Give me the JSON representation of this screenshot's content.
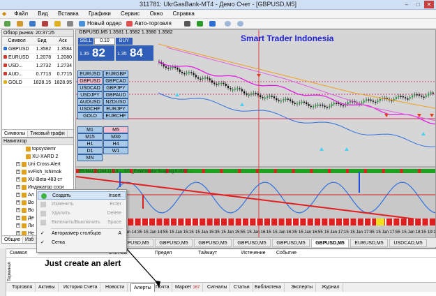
{
  "window": {
    "title": "311781: UkrGasBank-MT4 - Демо Счет - [GBPUSD,M5]"
  },
  "menu": [
    "Файл",
    "Вид",
    "Вставка",
    "Графики",
    "Сервис",
    "Окно",
    "Справка"
  ],
  "toolbar": {
    "new_order": "Новый ордер",
    "autotrading": "Авто-торговля"
  },
  "market_watch": {
    "title": "Обзор рынка: 20:37:25",
    "headers": [
      "Символ",
      "Бид",
      "Аск"
    ],
    "rows": [
      {
        "symbol": "GBPUSD",
        "bid": "1.3582",
        "ask": "1.3584",
        "color": "#2a6fd1"
      },
      {
        "symbol": "EURUSD",
        "bid": "1.2078",
        "ask": "1.2080",
        "color": "#d13a2a"
      },
      {
        "symbol": "USD...",
        "bid": "1.2732",
        "ask": "1.2734",
        "color": "#d13a2a"
      },
      {
        "symbol": "AUD...",
        "bid": "0.7713",
        "ask": "0.7715",
        "color": "#d13a2a"
      },
      {
        "symbol": "GOLD",
        "bid": "1828.15",
        "ask": "1828.95",
        "color": "#e0b020"
      }
    ],
    "tabs": [
      "Символы",
      "Тиковый графи"
    ]
  },
  "navigator": {
    "title": "Навигатор",
    "items": [
      "topsystemr",
      "XU-XARD 2",
      "Uni Cross Alert",
      "vvFish_Ishimok",
      "XU-Beta-483 ст",
      "Индикатор соси",
      "Ал",
      "Во",
      "Во",
      "Де",
      "Ли",
      "Не"
    ],
    "tabs": [
      "Общие",
      "Изб"
    ]
  },
  "chart": {
    "header": "GBPUSD,M5  1.3581 1.3582 1.3580 1.3582",
    "brand": "Smart Trader Indonesia",
    "trade_panel": {
      "sell": "SELL",
      "buy": "BUY",
      "lot": "0.10",
      "sell_price_small": "1.35",
      "sell_price_big": "82",
      "buy_price_small": "1.35",
      "buy_price_big": "84"
    },
    "pairs": [
      "EURUSD",
      "EURGBP",
      "GBPUSD",
      "GBPCAD",
      "USDCAD",
      "GBPJPY",
      "USDJPY",
      "GBPAUD",
      "AUDUSD",
      "NZDUSD",
      "USDCHF",
      "EURJPY",
      "GOLD",
      "EURCHF"
    ],
    "selected_pair": "GBPUSD",
    "timeframes": [
      "M1",
      "M5",
      "M15",
      "M30",
      "H1",
      "H4",
      "D1",
      "W1",
      "MN"
    ],
    "selected_tf": "M5",
    "sub_header": "BS MACD(244,1) 0.0 ... STL_Extermnator Scalping 0.0000 ...",
    "time_labels": [
      "15 Jan 14:35",
      "15 Jan 14:55",
      "15 Jan 15:15",
      "15 Jan 15:35",
      "15 Jan 15:55",
      "15 Jan 16:15",
      "15 Jan 16:35",
      "15 Jan 16:55",
      "15 Jan 17:15",
      "15 Jan 17:35",
      "15 Jan 17:55",
      "15 Jan 18:15",
      "19:15"
    ],
    "tabs": [
      "GBPUSD,M5",
      "GBPUSD,M5",
      "GBPUSD,M5",
      "GBPUSD,M5",
      "GBPUSD,M5",
      "GBPUSD,M5",
      "GBPUSD,M5",
      "EURUSD,M5",
      "USDCAD,M5"
    ],
    "active_tab": 6
  },
  "context_menu": {
    "items": [
      {
        "label": "Создать",
        "shortcut": "Insert",
        "disabled": false,
        "highlight": true
      },
      {
        "label": "Изменить",
        "shortcut": "Enter",
        "disabled": true
      },
      {
        "label": "Удалить",
        "shortcut": "Delete",
        "disabled": true
      },
      {
        "label": "Включить/Выключить",
        "shortcut": "Space",
        "disabled": true
      },
      {
        "label": "Авторазмер столбцов",
        "shortcut": "A",
        "disabled": false
      },
      {
        "label": "Сетка",
        "shortcut": "",
        "disabled": false
      }
    ]
  },
  "terminal": {
    "side_label": "Терминал",
    "columns": [
      "Символ",
      "Счетчик",
      "Предел",
      "Таймаут",
      "Истечение",
      "Событие"
    ],
    "tabs": [
      "Торговля",
      "Активы",
      "История Счета",
      "Новости",
      "Алерты",
      "Почта",
      "Маркет",
      "Сигналы",
      "Статьи",
      "Библиотека",
      "Эксперты",
      "Журнал"
    ],
    "market_badge": "167",
    "active_tab": "Алерты"
  },
  "annotation": "Just create an alert"
}
